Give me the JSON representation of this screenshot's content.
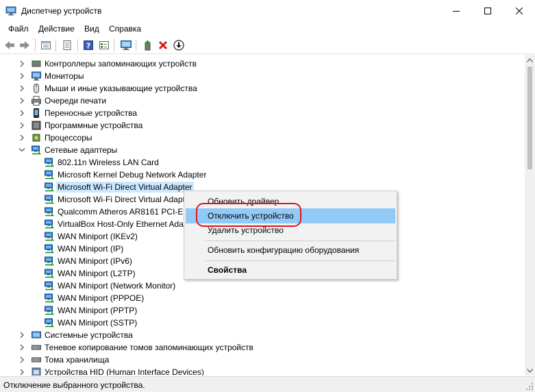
{
  "window": {
    "title": "Диспетчер устройств",
    "controls": [
      "minimize-icon",
      "maximize-icon",
      "close-icon"
    ]
  },
  "menu": [
    "Файл",
    "Действие",
    "Вид",
    "Справка"
  ],
  "toolbar": {
    "buttons": [
      "back-arrow-icon",
      "forward-arrow-icon",
      "show-properties-icon",
      "show-hidden-icon",
      "help-icon",
      "resources-view-icon",
      "monitor-scan-icon",
      "update-driver-icon",
      "uninstall-icon",
      "disable-device-icon"
    ]
  },
  "tree": {
    "rows": [
      {
        "label": "Контроллеры запоминающих устройств",
        "expander": "collapsed",
        "icon": "storage-controller-icon",
        "level": 1
      },
      {
        "label": "Мониторы",
        "expander": "collapsed",
        "icon": "monitor-icon",
        "level": 1
      },
      {
        "label": "Мыши и иные указывающие устройства",
        "expander": "collapsed",
        "icon": "mouse-icon",
        "level": 1
      },
      {
        "label": "Очереди печати",
        "expander": "collapsed",
        "icon": "printer-icon",
        "level": 1
      },
      {
        "label": "Переносные устройства",
        "expander": "collapsed",
        "icon": "portable-device-icon",
        "level": 1
      },
      {
        "label": "Программные устройства",
        "expander": "collapsed",
        "icon": "software-device-icon",
        "level": 1
      },
      {
        "label": "Процессоры",
        "expander": "collapsed",
        "icon": "processor-icon",
        "level": 1
      },
      {
        "label": "Сетевые адаптеры",
        "expander": "expanded",
        "icon": "network-adapter-icon",
        "level": 1
      },
      {
        "label": "802.11n Wireless LAN Card",
        "expander": "none",
        "icon": "network-adapter-icon",
        "level": 2
      },
      {
        "label": "Microsoft Kernel Debug Network Adapter",
        "expander": "none",
        "icon": "network-adapter-icon",
        "level": 2
      },
      {
        "label": "Microsoft Wi-Fi Direct Virtual Adapter",
        "expander": "none",
        "icon": "network-adapter-icon",
        "level": 2,
        "selected": true
      },
      {
        "label": "Microsoft Wi-Fi Direct Virtual Adapt",
        "expander": "none",
        "icon": "network-adapter-icon",
        "level": 2
      },
      {
        "label": "Qualcomm Atheros AR8161 PCI-E (",
        "expander": "none",
        "icon": "network-adapter-icon",
        "level": 2
      },
      {
        "label": "VirtualBox Host-Only Ethernet Ada",
        "expander": "none",
        "icon": "network-adapter-icon",
        "level": 2
      },
      {
        "label": "WAN Miniport (IKEv2)",
        "expander": "none",
        "icon": "network-adapter-icon",
        "level": 2
      },
      {
        "label": "WAN Miniport (IP)",
        "expander": "none",
        "icon": "network-adapter-icon",
        "level": 2
      },
      {
        "label": "WAN Miniport (IPv6)",
        "expander": "none",
        "icon": "network-adapter-icon",
        "level": 2
      },
      {
        "label": "WAN Miniport (L2TP)",
        "expander": "none",
        "icon": "network-adapter-icon",
        "level": 2
      },
      {
        "label": "WAN Miniport (Network Monitor)",
        "expander": "none",
        "icon": "network-adapter-icon",
        "level": 2
      },
      {
        "label": "WAN Miniport (PPPOE)",
        "expander": "none",
        "icon": "network-adapter-icon",
        "level": 2
      },
      {
        "label": "WAN Miniport (PPTP)",
        "expander": "none",
        "icon": "network-adapter-icon",
        "level": 2
      },
      {
        "label": "WAN Miniport (SSTP)",
        "expander": "none",
        "icon": "network-adapter-icon",
        "level": 2
      },
      {
        "label": "Системные устройства",
        "expander": "collapsed",
        "icon": "system-device-icon",
        "level": 1
      },
      {
        "label": "Теневое копирование томов запоминающих устройств",
        "expander": "collapsed",
        "icon": "volume-shadow-icon",
        "level": 1
      },
      {
        "label": "Тома хранилища",
        "expander": "collapsed",
        "icon": "storage-volume-icon",
        "level": 1
      },
      {
        "label": "Устройства HID (Human Interface Devices)",
        "expander": "collapsed",
        "icon": "hid-device-icon",
        "level": 1
      }
    ]
  },
  "context_menu": {
    "items": [
      {
        "label": "Обновить драйвер",
        "highlighted": false,
        "bold": false
      },
      {
        "label": "Отключить устройство",
        "highlighted": true,
        "bold": false
      },
      {
        "label": "Удалить устройство",
        "highlighted": false,
        "bold": false
      },
      {
        "label": "Обновить конфигурацию оборудования",
        "highlighted": false,
        "bold": false
      },
      {
        "label": "Свойства",
        "highlighted": false,
        "bold": true
      }
    ]
  },
  "statusbar": {
    "text": "Отключение выбранного устройства."
  },
  "colors": {
    "selection": "#cce8ff",
    "menu_highlight": "#91c9f7",
    "annotation_ring": "#e0141b",
    "network_icon": "#1e73c8"
  }
}
